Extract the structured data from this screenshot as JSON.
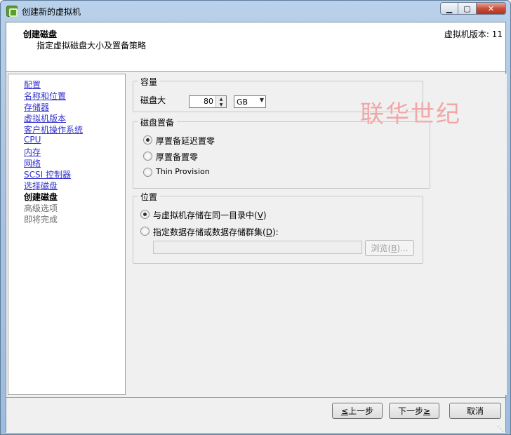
{
  "window": {
    "title": "创建新的虚拟机",
    "controls": {
      "minimize": "▁",
      "maximize": "▢",
      "close": "✕"
    }
  },
  "header": {
    "title": "创建磁盘",
    "subtitle": "指定虚拟磁盘大小及置备策略",
    "version": "虚拟机版本: 11"
  },
  "nav": {
    "items": [
      {
        "label": "配置",
        "state": "link"
      },
      {
        "label": "名称和位置",
        "state": "link"
      },
      {
        "label": "存储器",
        "state": "link"
      },
      {
        "label": "虚拟机版本",
        "state": "link"
      },
      {
        "label": "客户机操作系统",
        "state": "link"
      },
      {
        "label": "CPU",
        "state": "link"
      },
      {
        "label": "内存",
        "state": "link"
      },
      {
        "label": "网络",
        "state": "link"
      },
      {
        "label": "SCSI 控制器",
        "state": "link"
      },
      {
        "label": "选择磁盘",
        "state": "link"
      },
      {
        "label": "创建磁盘",
        "state": "current"
      },
      {
        "label": "高级选项",
        "state": "future"
      },
      {
        "label": "即将完成",
        "state": "future"
      }
    ]
  },
  "capacity": {
    "title": "容量",
    "disk_size_label": "磁盘大",
    "disk_size_value": "80",
    "unit": "GB"
  },
  "provisioning": {
    "title": "磁盘置备",
    "options": [
      {
        "label": "厚置备延迟置零",
        "checked": true
      },
      {
        "label": "厚置备置零",
        "checked": false
      },
      {
        "label": "Thin Provision",
        "checked": false
      }
    ]
  },
  "location": {
    "title": "位置",
    "opt1_text": "与虚拟机存储在同一目录中(",
    "opt1_key": "V",
    "opt1_end": ")",
    "opt2_text": "指定数据存储或数据存储群集(",
    "opt2_key": "D",
    "opt2_end": "):",
    "path_value": "",
    "browse_key": "B",
    "browse_prefix": "浏览(",
    "browse_suffix": ")..."
  },
  "watermark": "联华世纪",
  "buttons": {
    "back_key": "≤",
    "back_text": " 上一步",
    "next_text": "下一步 ",
    "next_key": "≥",
    "cancel": "取消"
  },
  "icons": {
    "app": "vsphere-app-icon",
    "spin_up": "▲",
    "spin_down": "▼",
    "dropdown": "▼"
  }
}
